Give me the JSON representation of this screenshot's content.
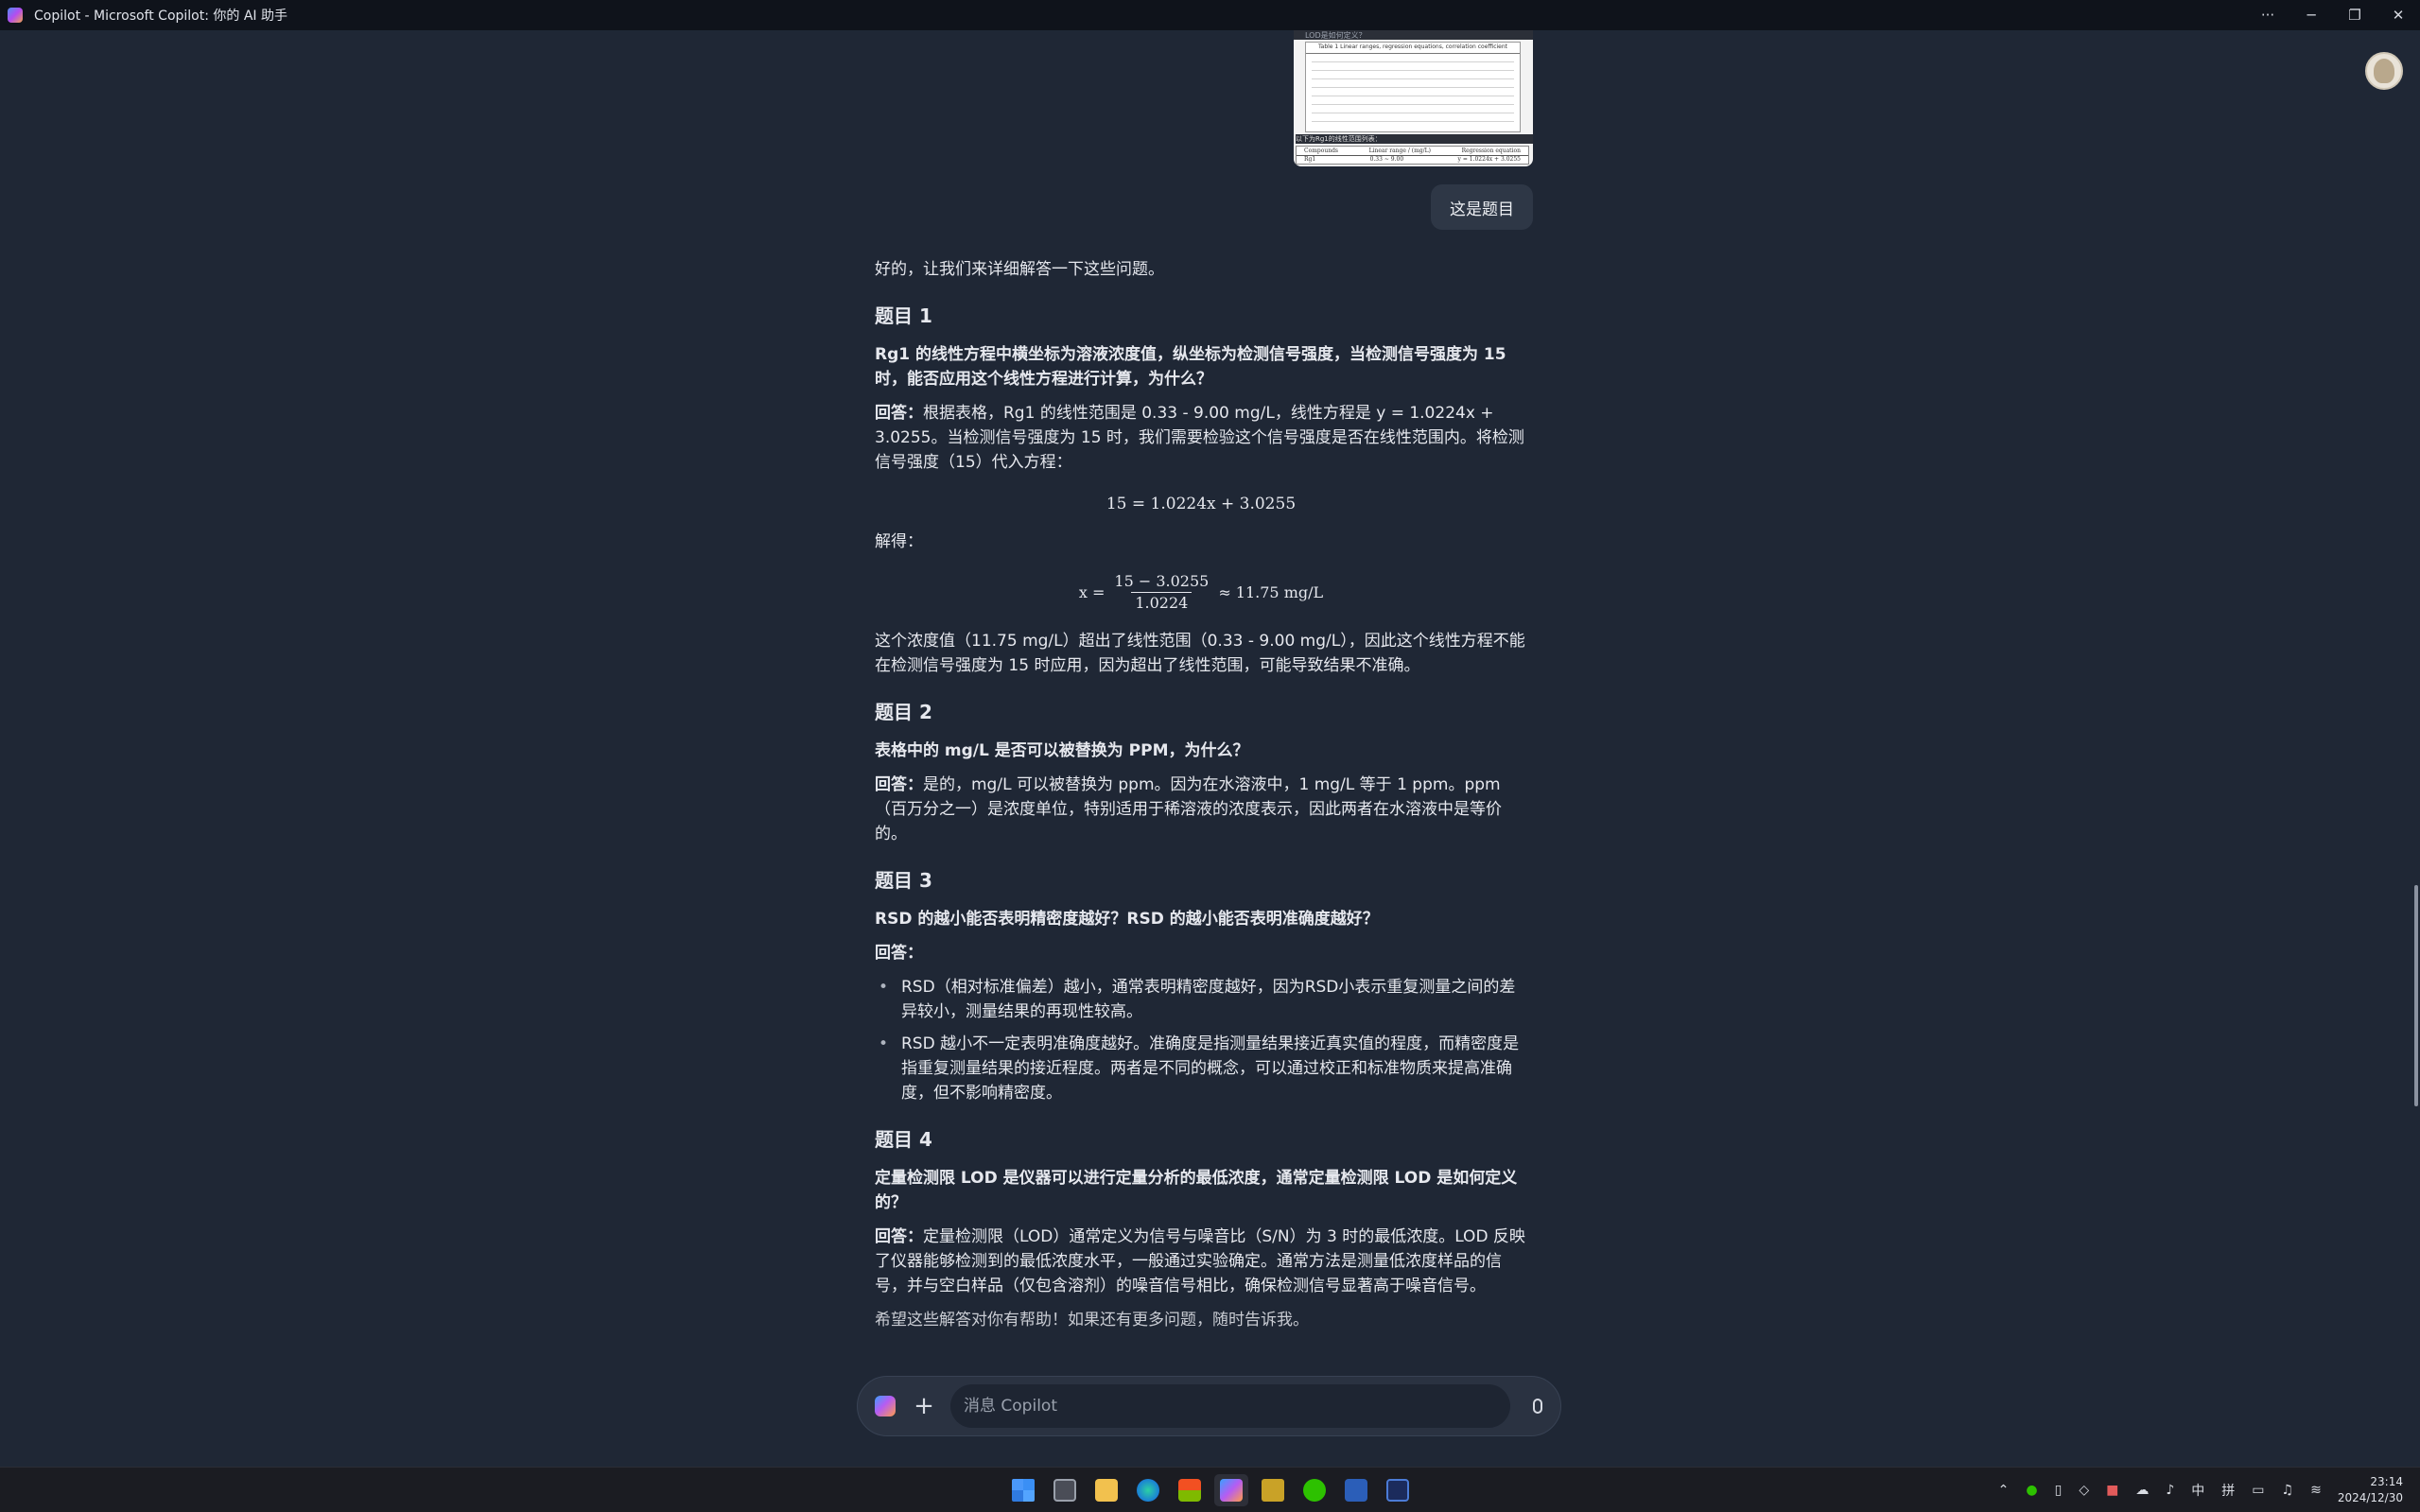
{
  "window": {
    "title": "Copilot - Microsoft Copilot: 你的 AI 助手",
    "controls": [
      "···",
      "─",
      "❐",
      "✕"
    ]
  },
  "attachment": {
    "caption": "LOD是如何定义？",
    "table_title": "Table 1  Linear ranges, regression equations, correlation coefficient",
    "note": "以下为Rg1的线性范围列表：",
    "bottom_headers": [
      "Compounds",
      "Linear range / (mg/L)",
      "Regression equation"
    ],
    "bottom_row": [
      "Rg1",
      "0.33 ~ 9.00",
      "y = 1.0224x + 3.0255"
    ]
  },
  "user_message": "这是题目",
  "answer": {
    "intro": "好的，让我们来详细解答一下这些问题。",
    "s1": {
      "heading": "题目 1",
      "question": "Rg1 的线性方程中横坐标为溶液浓度值，纵坐标为检测信号强度，当检测信号强度为 15 时，能否应用这个线性方程进行计算，为什么？",
      "label": "回答：",
      "answer": "根据表格，Rg1 的线性范围是 0.33 - 9.00 mg/L，线性方程是 y = 1.0224x + 3.0255。当检测信号强度为 15 时，我们需要检验这个信号强度是否在线性范围内。将检测信号强度（15）代入方程：",
      "equation": "15 = 1.0224x + 3.0255",
      "solve_label": "解得：",
      "frac_lhs": "x =",
      "frac_num": "15 − 3.0255",
      "frac_den": "1.0224",
      "frac_rhs": "≈ 11.75 mg/L",
      "conclusion": "这个浓度值（11.75 mg/L）超出了线性范围（0.33 - 9.00 mg/L），因此这个线性方程不能在检测信号强度为 15 时应用，因为超出了线性范围，可能导致结果不准确。"
    },
    "s2": {
      "heading": "题目 2",
      "question": "表格中的 mg/L 是否可以被替换为 PPM，为什么？",
      "label": "回答：",
      "answer": "是的，mg/L 可以被替换为 ppm。因为在水溶液中，1 mg/L 等于 1 ppm。ppm（百万分之一）是浓度单位，特别适用于稀溶液的浓度表示，因此两者在水溶液中是等价的。"
    },
    "s3": {
      "heading": "题目 3",
      "question": "RSD 的越小能否表明精密度越好？RSD 的越小能否表明准确度越好？",
      "label": "回答：",
      "bullets": [
        "RSD（相对标准偏差）越小，通常表明精密度越好，因为RSD小表示重复测量之间的差异较小，测量结果的再现性较高。",
        "RSD 越小不一定表明准确度越好。准确度是指测量结果接近真实值的程度，而精密度是指重复测量结果的接近程度。两者是不同的概念，可以通过校正和标准物质来提高准确度，但不影响精密度。"
      ]
    },
    "s4": {
      "heading": "题目 4",
      "question": "定量检测限 LOD 是仪器可以进行定量分析的最低浓度，通常定量检测限 LOD 是如何定义的？",
      "label": "回答：",
      "answer": "定量检测限（LOD）通常定义为信号与噪音比（S/N）为 3 时的最低浓度。LOD 反映了仪器能够检测到的最低浓度水平，一般通过实验确定。通常方法是测量低浓度样品的信号，并与空白样品（仅包含溶剂）的噪音信号相比，确保检测信号显著高于噪音信号。"
    },
    "closing": "希望这些解答对你有帮助！如果还有更多问题，随时告诉我。"
  },
  "input": {
    "placeholder": "消息 Copilot"
  },
  "taskbar": {
    "apps": [
      "windows-start",
      "task-view",
      "file-explorer",
      "edge",
      "store",
      "copilot",
      "app",
      "wechat",
      "word",
      "app2"
    ],
    "tray": {
      "ime_lang": "中",
      "ime_mode": "拼",
      "time": "23:14",
      "date": "2024/12/30"
    }
  },
  "colors": {
    "background": "#1f2735",
    "bubble": "#2e3746",
    "taskbar": "#1b1c22"
  }
}
